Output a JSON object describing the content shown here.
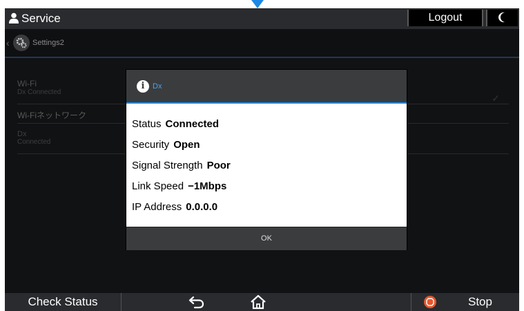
{
  "topbar": {
    "title": "Service",
    "logout_label": "Logout"
  },
  "breadcrumb": {
    "title": "Settings2"
  },
  "list": {
    "wifi_title": "Wi-Fi",
    "wifi_sub": "Dx Connected",
    "network_header": "Wi-Fiネットワーク",
    "net_name": "Dx",
    "net_status": "Connected"
  },
  "dialog": {
    "title": "Dx",
    "rows": [
      {
        "label": "Status",
        "value": "Connected"
      },
      {
        "label": "Security",
        "value": "Open"
      },
      {
        "label": "Signal Strength",
        "value": "Poor"
      },
      {
        "label": "Link Speed",
        "value": "−1Mbps"
      },
      {
        "label": "IP Address",
        "value": "0.0.0.0"
      }
    ],
    "ok_label": "OK"
  },
  "bottombar": {
    "check_status_label": "Check Status",
    "stop_label": "Stop"
  },
  "colors": {
    "accent": "#1e88e5",
    "stop": "#e4572e",
    "bar": "#2a2b2e"
  },
  "icons": [
    "user-icon",
    "moon-icon",
    "gear-icon",
    "info-icon",
    "back-arrow-icon",
    "home-icon",
    "stop-icon",
    "check-icon"
  ]
}
